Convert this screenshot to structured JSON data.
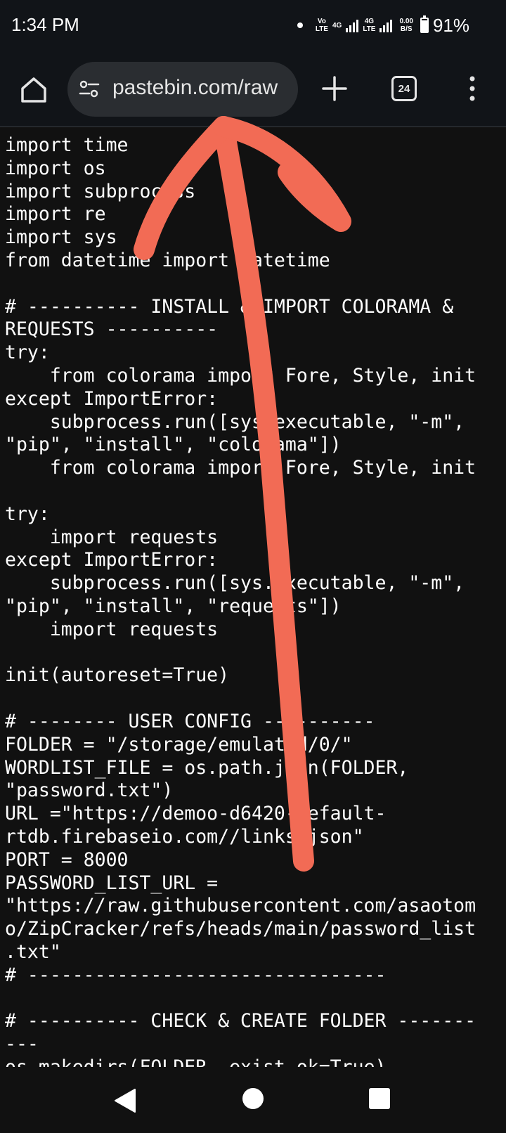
{
  "status_bar": {
    "time": "1:34 PM",
    "volte_line1": "Vo",
    "volte_line2": "LTE",
    "net1": "4G",
    "net2_line1": "4G",
    "net2_line2": "LTE",
    "speed_line1": "0.00",
    "speed_line2": "B/S",
    "battery_percent": "91%",
    "battery_level": 0.91
  },
  "toolbar": {
    "url": "pastebin.com/raw",
    "tab_count": "24",
    "home_icon": "home-icon",
    "site_info_icon": "tune-icon",
    "new_tab_icon": "plus-icon",
    "menu_icon": "more-vert-icon"
  },
  "code_lines": [
    "import time",
    "import os",
    "import subprocess",
    "import re",
    "import sys",
    "from datetime import datetime",
    "",
    "# ---------- INSTALL & IMPORT COLORAMA &",
    "REQUESTS ----------",
    "try:",
    "    from colorama import Fore, Style, init",
    "except ImportError:",
    "    subprocess.run([sys.executable, \"-m\",",
    "\"pip\", \"install\", \"colorama\"])",
    "    from colorama import Fore, Style, init",
    "",
    "try:",
    "    import requests",
    "except ImportError:",
    "    subprocess.run([sys.executable, \"-m\",",
    "\"pip\", \"install\", \"requests\"])",
    "    import requests",
    "",
    "init(autoreset=True)",
    "",
    "# -------- USER CONFIG ----------",
    "FOLDER = \"/storage/emulated/0/\"",
    "WORDLIST_FILE = os.path.join(FOLDER,",
    "\"password.txt\")",
    "URL =\"https://demoo-d6420-default-",
    "rtdb.firebaseio.com//links.json\"",
    "PORT = 8000",
    "PASSWORD_LIST_URL =",
    "\"https://raw.githubusercontent.com/asaotom",
    "o/ZipCracker/refs/heads/main/password_list",
    ".txt\"",
    "# --------------------------------",
    "",
    "# ---------- CHECK & CREATE FOLDER -------",
    "---",
    "os.makedirs(FOLDER, exist_ok=True)"
  ],
  "annotation": {
    "color": "#F26B55"
  },
  "nav_bar": {
    "back_icon": "back-triangle-icon",
    "home_icon": "home-circle-icon",
    "recents_icon": "recents-square-icon"
  }
}
